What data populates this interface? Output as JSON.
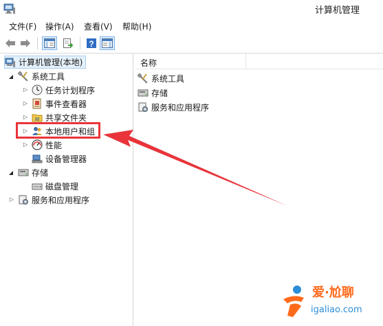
{
  "window": {
    "title": "计算机管理"
  },
  "menu": [
    "文件(F)",
    "操作(A)",
    "查看(V)",
    "帮助(H)"
  ],
  "toolbar": {
    "icons": [
      "back-icon",
      "forward-icon",
      "show-hide-tree-icon",
      "export-list-icon",
      "help-icon",
      "show-hide-action-pane-icon"
    ]
  },
  "tree": {
    "root": "计算机管理(本地)",
    "system_tools": {
      "label": "系统工具",
      "children": [
        "任务计划程序",
        "事件查看器",
        "共享文件夹",
        "本地用户和组",
        "性能",
        "设备管理器"
      ]
    },
    "storage": {
      "label": "存储",
      "children": [
        "磁盘管理"
      ]
    },
    "services": {
      "label": "服务和应用程序"
    }
  },
  "list": {
    "column_header": "名称",
    "items": [
      "系统工具",
      "存储",
      "服务和应用程序"
    ]
  },
  "watermark": {
    "brand": "爱·尬聊",
    "site": "igaliao.com"
  },
  "colors": {
    "annotation": "#e8343a",
    "selection": "#e5f1fb"
  }
}
